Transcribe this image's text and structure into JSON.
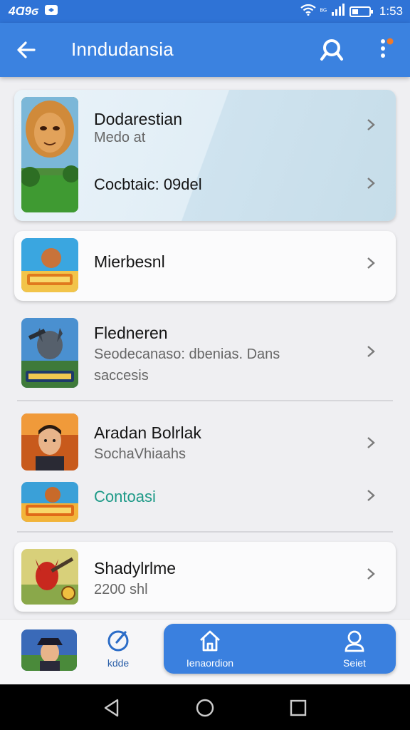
{
  "status_bar": {
    "left_text": "4Ɑ9ϭ",
    "time": "1:53",
    "network_label": "ᴮᴳ"
  },
  "app_bar": {
    "title": "Inndudansia"
  },
  "items": [
    {
      "title": "Dodarestian",
      "subtitle": "Medo at",
      "secondary": "Cocbtaic: 09del"
    },
    {
      "title": "Mierbesnl"
    },
    {
      "title": "Fledneren",
      "subtitle_line1": "Seodecanaso: dbenias. Dans",
      "subtitle_line2": "saccesis"
    },
    {
      "title": "Aradan Bolrlak",
      "subtitle": "SochaVhiaahs",
      "accent": "Contoasi"
    },
    {
      "title": "Shadylrlme",
      "subtitle": "2200 shl"
    }
  ],
  "bottom_nav": {
    "tab1": "kdde",
    "tab2": "Ienaordion",
    "tab3": "Seiet"
  },
  "colors": {
    "primary": "#3b82e0",
    "status_bar": "#2f73d6",
    "accent_text": "#1e9a88",
    "background": "#efeff2"
  },
  "icons": [
    "back-arrow-icon",
    "search-icon",
    "more-vert-icon",
    "chevron-right-icon",
    "home-icon",
    "person-icon",
    "edit-circle-icon",
    "nav-back-icon",
    "nav-home-icon",
    "nav-recents-icon",
    "wifi-icon",
    "signal-icon",
    "battery-icon"
  ]
}
